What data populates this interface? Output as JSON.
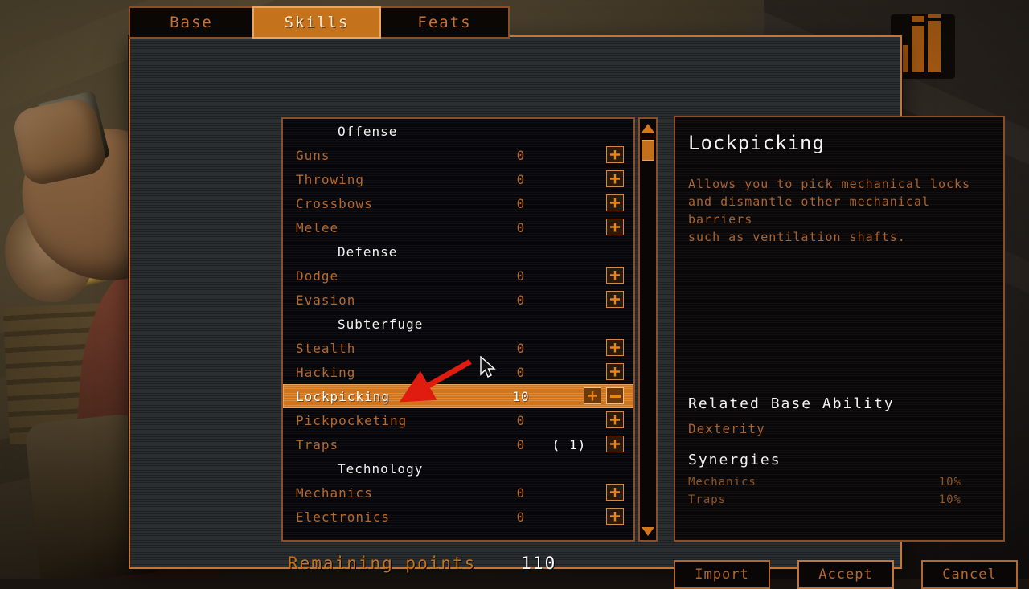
{
  "tabs": [
    {
      "label": "Base",
      "active": false
    },
    {
      "label": "Skills",
      "active": true
    },
    {
      "label": "Feats",
      "active": false
    }
  ],
  "skill_list": [
    {
      "type": "header",
      "label": "Offense"
    },
    {
      "type": "skill",
      "label": "Guns",
      "value": "0",
      "paren": "",
      "selected": false
    },
    {
      "type": "skill",
      "label": "Throwing",
      "value": "0",
      "paren": "",
      "selected": false
    },
    {
      "type": "skill",
      "label": "Crossbows",
      "value": "0",
      "paren": "",
      "selected": false
    },
    {
      "type": "skill",
      "label": "Melee",
      "value": "0",
      "paren": "",
      "selected": false
    },
    {
      "type": "header",
      "label": "Defense"
    },
    {
      "type": "skill",
      "label": "Dodge",
      "value": "0",
      "paren": "",
      "selected": false
    },
    {
      "type": "skill",
      "label": "Evasion",
      "value": "0",
      "paren": "",
      "selected": false
    },
    {
      "type": "header",
      "label": "Subterfuge"
    },
    {
      "type": "skill",
      "label": "Stealth",
      "value": "0",
      "paren": "",
      "selected": false
    },
    {
      "type": "skill",
      "label": "Hacking",
      "value": "0",
      "paren": "",
      "selected": false
    },
    {
      "type": "skill",
      "label": "Lockpicking",
      "value": "10",
      "paren": "",
      "selected": true
    },
    {
      "type": "skill",
      "label": "Pickpocketing",
      "value": "0",
      "paren": "",
      "selected": false
    },
    {
      "type": "skill",
      "label": "Traps",
      "value": "0",
      "paren": "( 1)",
      "selected": false
    },
    {
      "type": "header",
      "label": "Technology"
    },
    {
      "type": "skill",
      "label": "Mechanics",
      "value": "0",
      "paren": "",
      "selected": false
    },
    {
      "type": "skill",
      "label": "Electronics",
      "value": "0",
      "paren": "",
      "selected": false
    }
  ],
  "info": {
    "title": "Lockpicking",
    "description": [
      "Allows you to pick mechanical locks",
      "and dismantle other mechanical barriers",
      "such as ventilation shafts."
    ],
    "related_ability_heading": "Related Base Ability",
    "related_ability": "Dexterity",
    "synergies_heading": "Synergies",
    "synergies": [
      {
        "name": "Mechanics",
        "value": "10%"
      },
      {
        "name": "Traps",
        "value": "10%"
      }
    ]
  },
  "footer": {
    "remaining_label": "Remaining points",
    "remaining_value": "110",
    "buttons": [
      {
        "label": "Import"
      },
      {
        "label": "Accept"
      },
      {
        "label": "Cancel"
      }
    ]
  },
  "controls": {
    "increase_icon": "plus-icon",
    "decrease_icon": "minus-icon",
    "scroll_up_icon": "triangle-up-icon",
    "scroll_down_icon": "triangle-down-icon",
    "cursor_icon": "mouse-pointer-icon",
    "annotation_icon": "red-arrow-annotation"
  },
  "colors": {
    "accent_orange": "#c4731c",
    "highlight_row": "#d1741a",
    "skill_text": "#b5692c",
    "header_text": "#f2f2f2",
    "panel_bg": "#262a2c",
    "annotation_red": "#e01b० "
  }
}
